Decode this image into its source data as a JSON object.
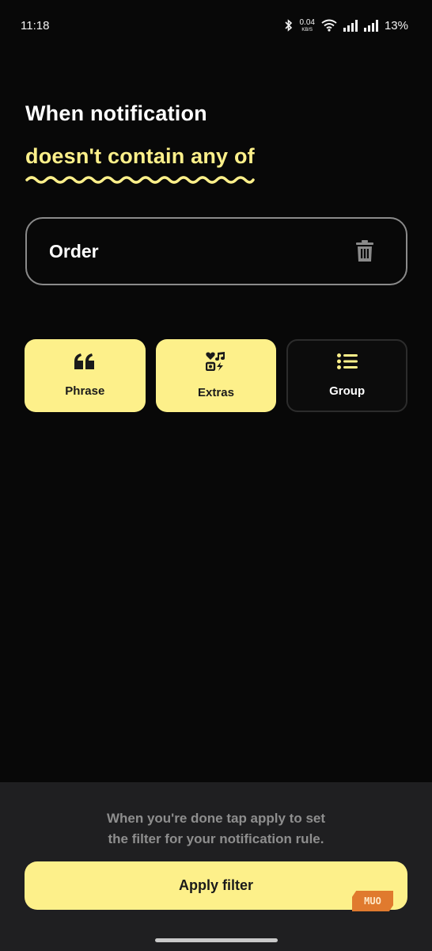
{
  "status_bar": {
    "time": "11:18",
    "net_speed": "0.04",
    "net_unit": "KB/S",
    "battery": "13%",
    "icons": [
      "bluetooth-icon",
      "wifi-icon",
      "signal-icon",
      "signal-icon"
    ]
  },
  "header": {
    "line1": "When notification",
    "line2": "doesn't contain any of"
  },
  "term": {
    "text": "Order",
    "delete_icon": "trash-icon"
  },
  "options": [
    {
      "label": "Phrase",
      "icon": "quote-icon",
      "style": "filled"
    },
    {
      "label": "Extras",
      "icon": "extras-icon",
      "style": "filled"
    },
    {
      "label": "Group",
      "icon": "list-icon",
      "style": "outline"
    }
  ],
  "footer": {
    "hint_line1": "When you're done tap apply to set",
    "hint_line2": "the filter for your notification rule.",
    "apply_label": "Apply filter",
    "watermark": "MUO"
  },
  "colors": {
    "accent": "#fdf08a",
    "background": "#080808",
    "sheet": "#1f1f21",
    "border": "#8a8a8a"
  }
}
